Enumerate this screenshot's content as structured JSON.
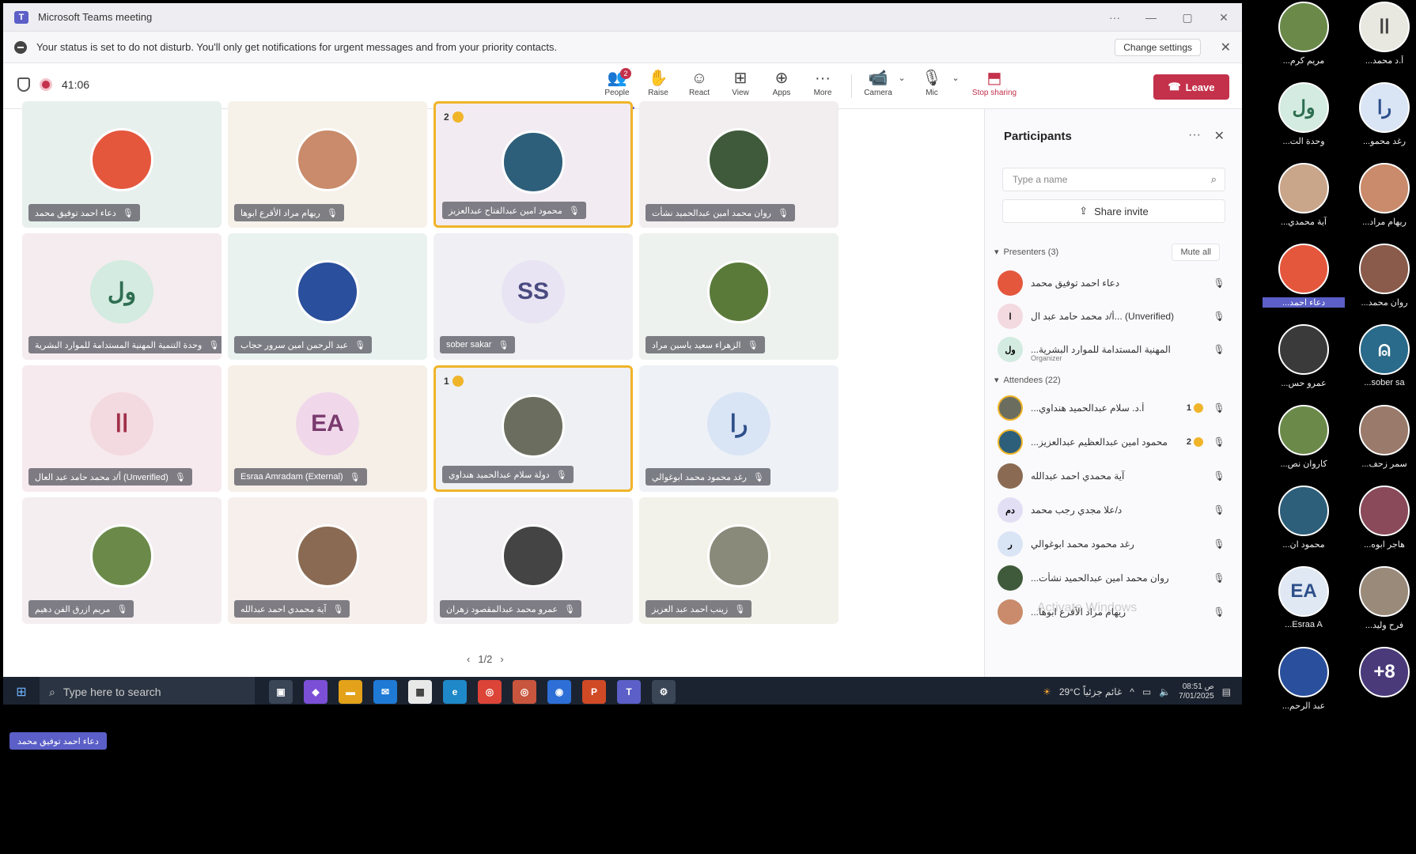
{
  "window": {
    "title": "Microsoft Teams meeting"
  },
  "notice": {
    "message": "Your status is set to do not disturb. You'll only get notifications for urgent messages and from your priority contacts.",
    "change_settings": "Change settings"
  },
  "toolbar": {
    "timer": "41:06",
    "people_label": "People",
    "people_badge": "2",
    "raise_label": "Raise",
    "react_label": "React",
    "view_label": "View",
    "apps_label": "Apps",
    "more_label": "More",
    "camera_label": "Camera",
    "mic_label": "Mic",
    "share_label": "Stop sharing",
    "leave_label": "Leave"
  },
  "tiles": [
    {
      "name": "دعاء احمد توفيق محمد",
      "initials": "",
      "color": "#e4573d"
    },
    {
      "name": "ريهام مراد الأقرع ابوها",
      "initials": "",
      "color": "#c98b6b"
    },
    {
      "name": "محمود امين عبدالفتاح عبدالعزيز",
      "initials": "",
      "color": "#2d5f7a",
      "hand": "2"
    },
    {
      "name": "روان محمد امين عبدالحميد نشأت",
      "initials": "",
      "color": "#3f5a3a"
    },
    {
      "name": "وحدة التنمية المهنية المستدامة للموارد البشرية",
      "initials": "ول",
      "color": "#d3ebe0",
      "text": "#2e6e51"
    },
    {
      "name": "عبد الرحمن امين سرور حجاب",
      "initials": "",
      "color": "#2a4f9c"
    },
    {
      "name": "sober sakar",
      "initials": "SS",
      "color": "#e8e4f3",
      "text": "#4a4a80"
    },
    {
      "name": "الزهراء سعيد ياسين مراد",
      "initials": "",
      "color": "#5a7a3a"
    },
    {
      "name": "أ/د محمد حامد عبد العال (Unverified)",
      "initials": "اا",
      "color": "#f3d9e0",
      "text": "#a0304a"
    },
    {
      "name": "Esraa Amradam (External)",
      "initials": "EA",
      "color": "#f0d8ea",
      "text": "#7a3a6e"
    },
    {
      "name": "دولة سلام عبدالحميد هنداوي",
      "initials": "",
      "color": "#6b6d5e",
      "hand": "1"
    },
    {
      "name": "رغد محمود محمد ابوغوالي",
      "initials": "را",
      "color": "#d9e4f5",
      "text": "#2e4f8a"
    },
    {
      "name": "مريم ازرق الفن دهيم",
      "initials": "",
      "color": "#6b8a4a"
    },
    {
      "name": "آية محمدي احمد عبدالله",
      "initials": "",
      "color": "#8a6a52"
    },
    {
      "name": "عمرو محمد عبدالمقصود زهران",
      "initials": "",
      "color": "#444444"
    },
    {
      "name": "زينب احمد عبد العزيز",
      "initials": "",
      "color": "#8a8a7a"
    }
  ],
  "pager": {
    "text": "1/2"
  },
  "panel": {
    "title": "Participants",
    "search_placeholder": "Type a name",
    "share_invite": "Share invite",
    "presenters_label": "Presenters (3)",
    "mute_all": "Mute all",
    "attendees_label": "Attendees (22)",
    "presenters": [
      {
        "name": "دعاء احمد توفيق محمد",
        "sub": "",
        "color": "#e4573d",
        "initials": ""
      },
      {
        "name": "أ/د محمد حامد عبد ال... (Unverified)",
        "sub": "",
        "color": "#f3d9e0",
        "initials": "ا"
      },
      {
        "name": "...المهنية المستدامة للموارد البشرية",
        "sub": "Organizer",
        "color": "#d3ebe0",
        "initials": "ول"
      }
    ],
    "attendees": [
      {
        "name": "...أ.د. سلام عبدالحميد هنداوي",
        "hand": "1",
        "color": "#6b6d5e",
        "initials": ""
      },
      {
        "name": "...محمود امين عبدالعظيم عبدالعزيز",
        "hand": "2",
        "color": "#2d5f7a",
        "initials": ""
      },
      {
        "name": "آية محمدي احمد عبدالله",
        "hand": "",
        "color": "#8a6a52",
        "initials": ""
      },
      {
        "name": "د/علا مجدي رجب محمد",
        "hand": "",
        "color": "#e2dff5",
        "initials": "دم"
      },
      {
        "name": "رغد محمود محمد ابوغوالي",
        "hand": "",
        "color": "#d9e4f5",
        "initials": "ر"
      },
      {
        "name": "...روان محمد امين عبدالحميد نشأت",
        "hand": "",
        "color": "#3f5a3a",
        "initials": ""
      },
      {
        "name": "...ريهام مراد الأقرع ابوها",
        "hand": "",
        "color": "#c98b6b",
        "initials": ""
      }
    ],
    "watermark": "Activate Windows"
  },
  "taskbar": {
    "search_placeholder": "Type here to search",
    "weather": "29°C غائم جزئياً",
    "time": "08:51 ص",
    "date": "7/01/2025"
  },
  "strip": [
    {
      "label": "...مريم كرم",
      "initials": "",
      "color": "#6b8a4a"
    },
    {
      "label": "...أ.د محمد",
      "initials": "اا",
      "color": "#e8e8e0",
      "text": "#444"
    },
    {
      "label": "...وحدة الت",
      "initials": "ول",
      "color": "#d3ebe0",
      "text": "#2e6e51"
    },
    {
      "label": "...رغد محمو",
      "initials": "را",
      "color": "#d9e4f5",
      "text": "#2e4f8a"
    },
    {
      "label": "...آية محمدي",
      "initials": "",
      "color": "#c9a58a"
    },
    {
      "label": "...ريهام مراد",
      "initials": "",
      "color": "#c98b6b"
    },
    {
      "label": "...دعاء احمد",
      "initials": "",
      "color": "#e4573d",
      "hl": true
    },
    {
      "label": "...روان محمد",
      "initials": "",
      "color": "#8a5a4a"
    },
    {
      "label": "...عمرو حس",
      "initials": "",
      "color": "#3a3a3a"
    },
    {
      "label": "...sober sa",
      "initials": "",
      "color": "#2a6a8a",
      "icon": true
    },
    {
      "label": "...كاروان نص",
      "initials": "",
      "color": "#6b8a4a"
    },
    {
      "label": "...سمر زحف",
      "initials": "",
      "color": "#9a7a6a"
    },
    {
      "label": "...محمود ان",
      "initials": "",
      "color": "#2d5f7a"
    },
    {
      "label": "...هاجر ابوه",
      "initials": "",
      "color": "#8a4a5a"
    },
    {
      "label": "...Esraa A",
      "initials": "EA",
      "color": "#dfe8f3",
      "text": "#2e4f8a"
    },
    {
      "label": "...فرح وليد",
      "initials": "",
      "color": "#9a8a7a"
    },
    {
      "label": "...عبد الرحم",
      "initials": "",
      "color": "#2a4f9c"
    },
    {
      "label": "",
      "initials": "+8",
      "color": "#4a3a7a",
      "text": "#fff"
    }
  ],
  "bottom_tag": "دعاء احمد توفيق محمد"
}
